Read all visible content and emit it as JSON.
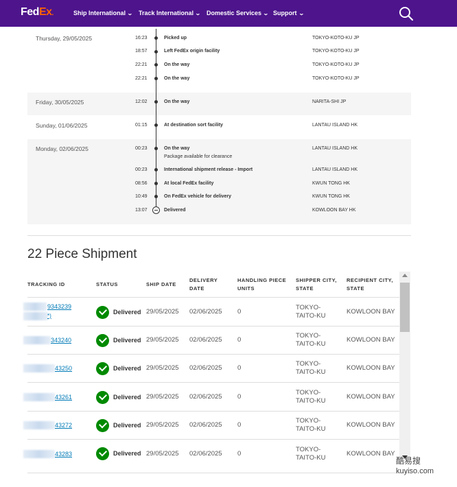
{
  "header": {
    "logo_fed": "Fed",
    "logo_ex": "Ex",
    "logo_dot": ".",
    "nav": [
      "Ship International",
      "Track International",
      "Domestic Services",
      "Support"
    ]
  },
  "history": [
    {
      "date": "Thursday, 29/05/2025",
      "events": [
        {
          "time": "16:23",
          "desc": "Picked up",
          "loc": "TOKYO-KOTO-KU JP"
        },
        {
          "time": "18:57",
          "desc": "Left FedEx origin facility",
          "loc": "TOKYO-KOTO-KU JP"
        },
        {
          "time": "22:21",
          "desc": "On the way",
          "loc": "TOKYO-KOTO-KU JP"
        },
        {
          "time": "22:21",
          "desc": "On the way",
          "loc": "TOKYO-KOTO-KU JP"
        }
      ]
    },
    {
      "date": "Friday, 30/05/2025",
      "events": [
        {
          "time": "12:02",
          "desc": "On the way",
          "loc": "NARITA-SHI JP"
        }
      ]
    },
    {
      "date": "Sunday, 01/06/2025",
      "events": [
        {
          "time": "01:15",
          "desc": "At destination sort facility",
          "loc": "LANTAU ISLAND HK"
        }
      ]
    },
    {
      "date": "Monday, 02/06/2025",
      "events": [
        {
          "time": "00:23",
          "desc": "On the way",
          "sub": "Package available for clearance",
          "loc": "LANTAU ISLAND HK"
        },
        {
          "time": "00:23",
          "desc": "International shipment release - Import",
          "loc": "LANTAU ISLAND HK"
        },
        {
          "time": "08:56",
          "desc": "At local FedEx facility",
          "loc": "KWUN TONG HK"
        },
        {
          "time": "10:49",
          "desc": "On FedEx vehicle for delivery",
          "loc": "KWUN TONG HK"
        },
        {
          "time": "13:07",
          "desc": "Delivered",
          "loc": "KOWLOON BAY HK"
        }
      ]
    }
  ],
  "pieces": {
    "title": "22 Piece Shipment",
    "columns": {
      "tracking": "TRACKING ID",
      "status": "STATUS",
      "ship": "SHIP DATE",
      "delivery_1": "DELIVERY",
      "delivery_2": "DATE",
      "handling_1": "HANDLING PIECE",
      "handling_2": "UNITS",
      "shipper_1": "SHIPPER CITY,",
      "shipper_2": "STATE",
      "recipient_1": "RECIPIENT CITY,",
      "recipient_2": "STATE"
    },
    "rows": [
      {
        "id": "9343239",
        "id_extra": "*)",
        "status": "Delivered",
        "ship": "29/05/2025",
        "delivery": "02/06/2025",
        "units": "0",
        "shipper_1": "TOKYO-",
        "shipper_2": "TAITO-KU",
        "recipient": "KOWLOON BAY"
      },
      {
        "id": "343240",
        "status": "Delivered",
        "ship": "29/05/2025",
        "delivery": "02/06/2025",
        "units": "0",
        "shipper_1": "TOKYO-",
        "shipper_2": "TAITO-KU",
        "recipient": "KOWLOON BAY"
      },
      {
        "id": "43250",
        "status": "Delivered",
        "ship": "29/05/2025",
        "delivery": "02/06/2025",
        "units": "0",
        "shipper_1": "TOKYO-",
        "shipper_2": "TAITO-KU",
        "recipient": "KOWLOON BAY"
      },
      {
        "id": "43261",
        "status": "Delivered",
        "ship": "29/05/2025",
        "delivery": "02/06/2025",
        "units": "0",
        "shipper_1": "TOKYO-",
        "shipper_2": "TAITO-KU",
        "recipient": "KOWLOON BAY"
      },
      {
        "id": "43272",
        "status": "Delivered",
        "ship": "29/05/2025",
        "delivery": "02/06/2025",
        "units": "0",
        "shipper_1": "TOKYO-",
        "shipper_2": "TAITO-KU",
        "recipient": "KOWLOON BAY"
      },
      {
        "id": "43283",
        "status": "Delivered",
        "ship": "29/05/2025",
        "delivery": "02/06/2025",
        "units": "0",
        "shipper_1": "TOKYO-",
        "shipper_2": "TAITO-KU",
        "recipient": "KOWLOON BAY"
      }
    ]
  },
  "watermark": {
    "line1": "酷易搜",
    "line2": "kuyiso.com"
  },
  "colors": {
    "brand_purple": "#4d148c",
    "brand_orange": "#ff6200",
    "delivered_green": "#008a00",
    "link_blue": "#007ab7"
  }
}
